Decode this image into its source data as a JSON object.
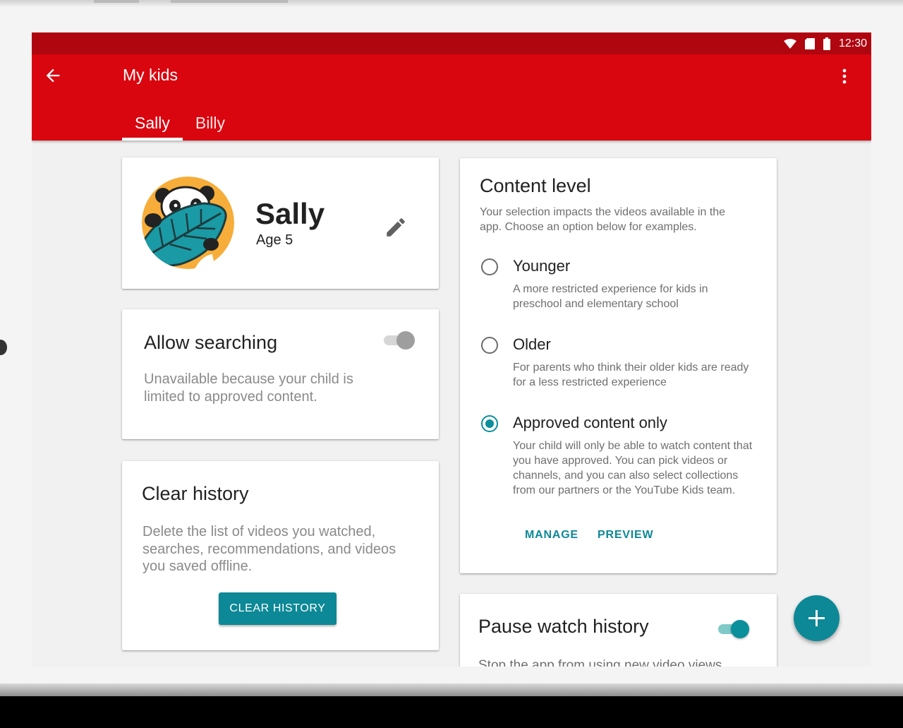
{
  "status_bar": {
    "time": "12:30",
    "icons": [
      "wifi-icon",
      "sim-card-icon",
      "battery-icon"
    ]
  },
  "app_bar": {
    "title": "My kids",
    "back_icon": "arrow-back-icon",
    "overflow_icon": "more-vert-icon",
    "tabs": [
      {
        "label": "Sally",
        "selected": true
      },
      {
        "label": "Billy",
        "selected": false
      }
    ]
  },
  "profile": {
    "name": "Sally",
    "age": "Age 5",
    "avatar_icon": "panda-leaf-avatar",
    "edit_icon": "pencil-icon"
  },
  "allow_searching": {
    "title": "Allow searching",
    "description": "Unavailable because your child is limited to approved content.",
    "enabled": false,
    "toggle_on": true
  },
  "clear_history": {
    "title": "Clear history",
    "description": "Delete the list of videos you watched, searches, recommendations, and videos you saved offline.",
    "button_label": "CLEAR HISTORY"
  },
  "content_level": {
    "title": "Content level",
    "description": "Your selection impacts the videos available in the app. Choose an option below for examples.",
    "options": [
      {
        "label": "Younger",
        "description": "A more restricted experience for kids in preschool and elementary school",
        "selected": false
      },
      {
        "label": "Older",
        "description": "For parents who think their older kids are ready for a less restricted experience",
        "selected": false
      },
      {
        "label": "Approved content only",
        "description": "Your child will only be able to watch content that you have approved. You can pick videos or channels, and you can also select collections from our partners or the YouTube Kids team.",
        "selected": true
      }
    ],
    "manage_label": "MANAGE",
    "preview_label": "PREVIEW"
  },
  "pause_watch_history": {
    "title": "Pause watch history",
    "description": "Stop the app from using new video views",
    "toggle_on": true
  },
  "fab": {
    "icon": "plus-icon"
  },
  "colors": {
    "status_bar": "#b00610",
    "app_bar": "#d9050f",
    "accent": "#0d8896",
    "toggle_disabled_thumb": "#9e9e9e",
    "toggle_active_thumb": "#0b8f9b"
  }
}
